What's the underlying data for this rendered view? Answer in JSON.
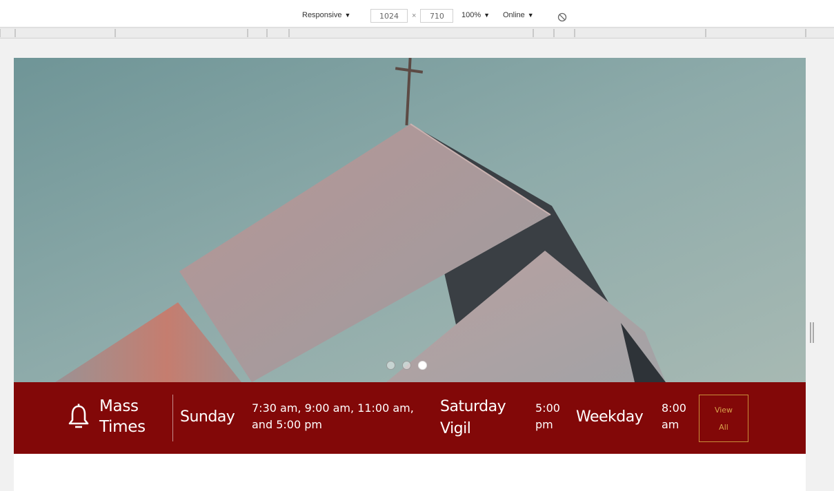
{
  "devtools": {
    "device": "Responsive",
    "width": "1024",
    "times": "×",
    "height": "710",
    "zoom": "100%",
    "network": "Online"
  },
  "slider": {
    "dot_count": 3,
    "active_index": 2
  },
  "mass_times": {
    "title_line1": "Mass",
    "title_line2": "Times",
    "sunday_label": "Sunday",
    "sunday_times_line1": "7:30 am, 9:00 am, 11:00 am,",
    "sunday_times_line2": "and 5:00 pm",
    "saturday_label_line1": "Saturday",
    "saturday_label_line2": "Vigil",
    "saturday_time_line1": "5:00",
    "saturday_time_line2": "pm",
    "weekday_label": "Weekday",
    "weekday_time_line1": "8:00",
    "weekday_time_line2": "am",
    "view_all_line1": "View",
    "view_all_line2": "All"
  },
  "colors": {
    "bar_background": "#820808",
    "accent_gold": "#c98f3a"
  },
  "icons": {
    "bell": "bell-icon",
    "throttle": "no-throttling-icon"
  }
}
